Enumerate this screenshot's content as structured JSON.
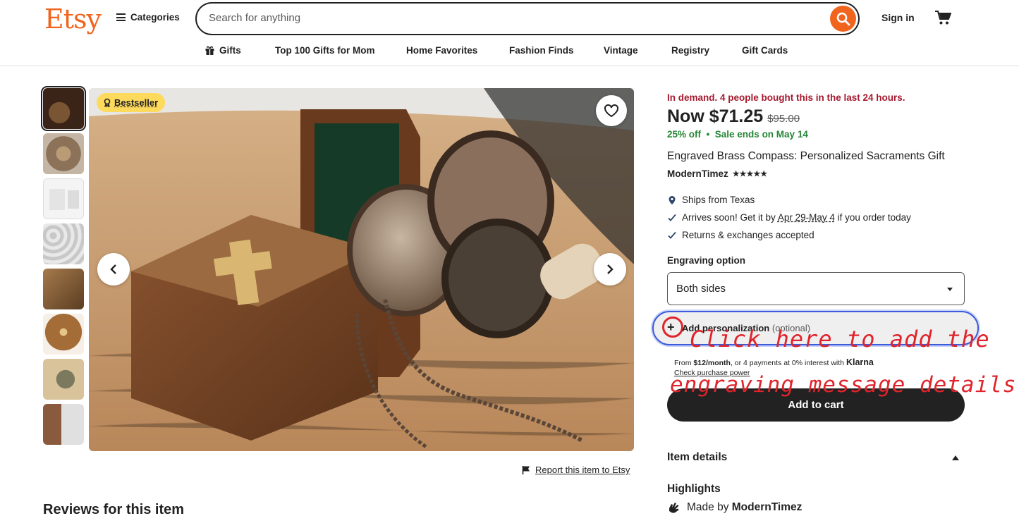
{
  "header": {
    "logo": "Etsy",
    "categories_label": "Categories",
    "search_placeholder": "Search for anything",
    "signin_label": "Sign in"
  },
  "nav": [
    "Gifts",
    "Top 100 Gifts for Mom",
    "Home Favorites",
    "Fashion Finds",
    "Vintage",
    "Registry",
    "Gift Cards"
  ],
  "gallery": {
    "badge": "Bestseller",
    "report_label": "Report this item to Etsy",
    "thumbnail_count": 8
  },
  "product": {
    "demand": "In demand. 4 people bought this in the last 24 hours.",
    "price_now": "Now $71.25",
    "price_original": "$95.00",
    "discount": "25% off",
    "sale_ends": "Sale ends on May 14",
    "title": "Engraved Brass Compass: Personalized Sacraments Gift",
    "shop_name": "ModernTimez",
    "stars": "★★★★★",
    "ships_from": "Ships from Texas",
    "arrives_prefix": "Arrives soon! Get it by ",
    "arrives_dates": "Apr 29-May 4",
    "arrives_suffix": " if you order today",
    "returns": "Returns & exchanges accepted",
    "engraving_label": "Engraving option",
    "engraving_value": "Both sides",
    "personalization_label": "Add personalization",
    "personalization_optional": "(optional)",
    "klarna_from": "From ",
    "klarna_amount": "$12/month",
    "klarna_rest": ", or 4 payments at 0% interest with ",
    "klarna_brand": "Klarna",
    "klarna_check": "Check purchase power",
    "add_to_cart": "Add to cart",
    "item_details": "Item details",
    "highlights": "Highlights",
    "made_by_prefix": "Made by ",
    "made_by_shop": "ModernTimez"
  },
  "annotation": {
    "line1": "Click here to add the",
    "line2": "engraving message details"
  },
  "reviews_heading": "Reviews for this item",
  "colors": {
    "brand": "#f1641e",
    "demand": "#a61a2e",
    "sale": "#258635",
    "annotation": "#e0242b",
    "focus": "#3b5bdb"
  }
}
